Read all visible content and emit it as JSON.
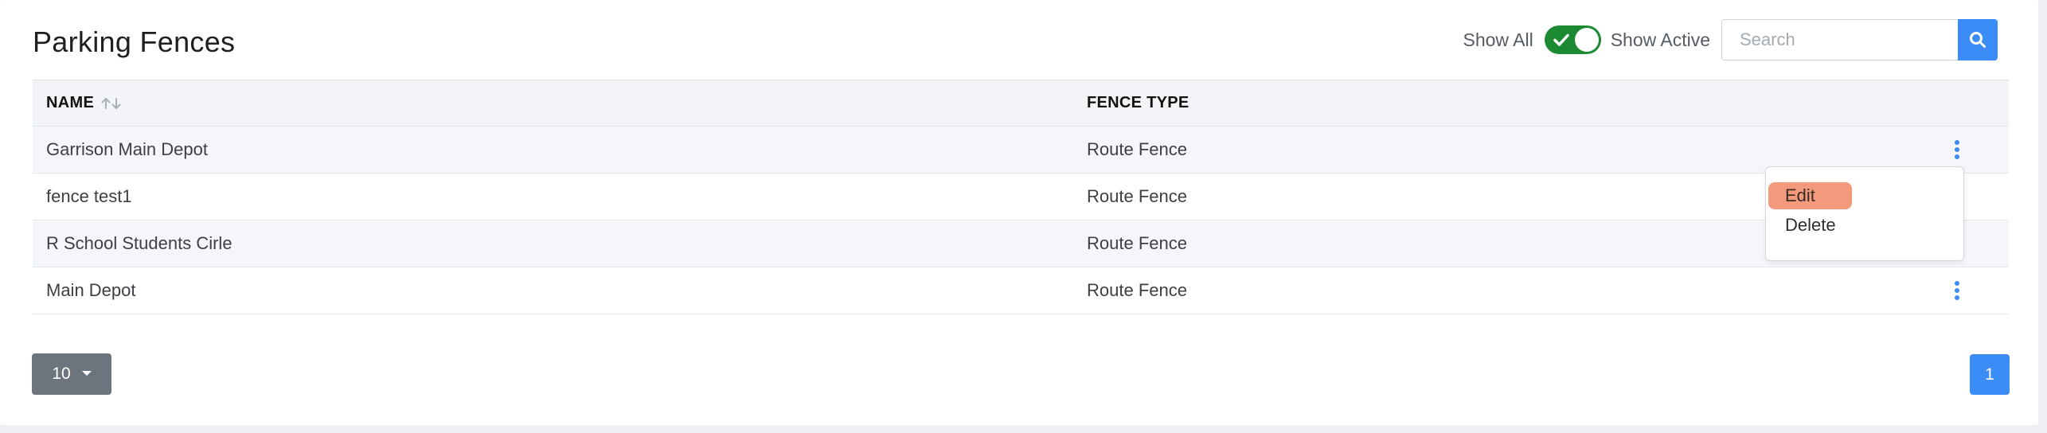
{
  "header": {
    "title": "Parking Fences",
    "toggle_left_label": "Show All",
    "toggle_right_label": "Show Active",
    "toggle_state": "active",
    "search_placeholder": "Search",
    "search_value": "",
    "search_icon": "search-icon"
  },
  "table": {
    "columns": [
      "NAME",
      "FENCE TYPE"
    ],
    "sort_icon": "sort-arrows-icon",
    "rows": [
      {
        "name": "Garrison Main Depot",
        "type": "Route Fence"
      },
      {
        "name": "fence test1",
        "type": "Route Fence"
      },
      {
        "name": "R School Students Cirle",
        "type": "Route Fence"
      },
      {
        "name": "Main Depot",
        "type": "Route Fence"
      }
    ],
    "row_action_icon": "kebab-menu-icon"
  },
  "row_menu": {
    "items": [
      "Edit",
      "Delete"
    ],
    "highlighted": "Edit"
  },
  "footer": {
    "page_size": "10",
    "current_page": "1"
  },
  "colors": {
    "accent": "#3c8cf7",
    "toggle_on": "#1c8a33",
    "menu_highlight": "#f39a7d",
    "page_size_bg": "#6c757d"
  }
}
